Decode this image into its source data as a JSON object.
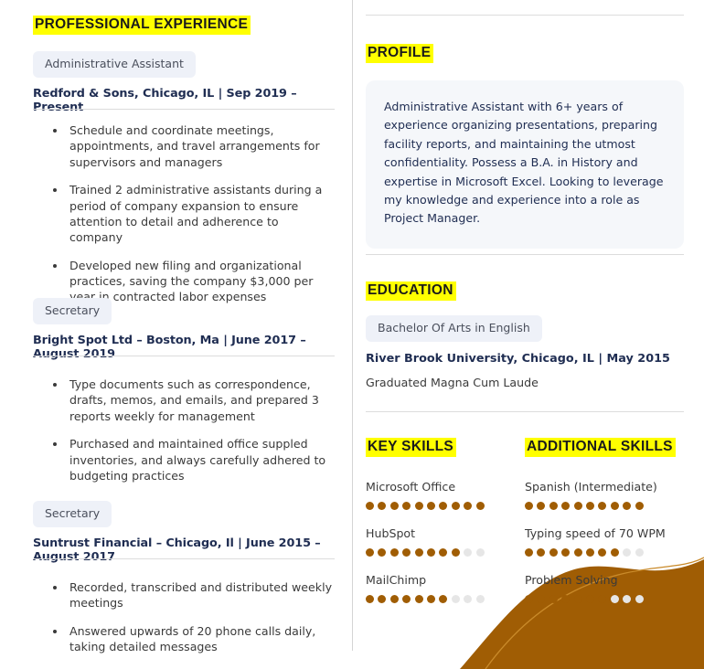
{
  "colors": {
    "highlight": "#ffff00",
    "accent_brown": "#a05d04",
    "navy": "#1f2d52",
    "pill_bg": "#eef1f8",
    "dot_empty": "#e6e6e6"
  },
  "left_column": {
    "heading": "PROFESSIONAL EXPERIENCE",
    "jobs": [
      {
        "title": "Administrative Assistant",
        "org": "Redford & Sons, Chicago, IL | Sep 2019 – Present",
        "bullets": [
          "Schedule and coordinate meetings, appointments, and travel arrangements for supervisors and managers",
          "Trained 2 administrative assistants during a period of company expansion to ensure attention to detail and adherence to company",
          "Developed new filing and organizational practices, saving the company $3,000 per year in contracted labor expenses"
        ]
      },
      {
        "title": "Secretary",
        "org": "Bright Spot Ltd – Boston, Ma | June 2017 – August 2019",
        "bullets": [
          "Type documents such as correspondence, drafts, memos, and emails, and prepared 3 reports weekly for management",
          "Purchased and maintained office suppled inventories, and always carefully adhered to budgeting practices"
        ]
      },
      {
        "title": "Secretary",
        "org": "Suntrust Financial – Chicago, Il | June 2015 – August 2017",
        "bullets": [
          "Recorded, transcribed and distributed weekly meetings",
          "Answered upwards of 20 phone calls daily, taking detailed messages"
        ]
      }
    ]
  },
  "right_column": {
    "profile": {
      "heading": "PROFILE",
      "text": "Administrative Assistant with 6+ years of experience organizing presentations, preparing facility reports, and maintaining the utmost confidentiality. Possess a B.A. in History and expertise in Microsoft Excel. Looking to leverage my knowledge and experience into a role as Project Manager."
    },
    "education": {
      "heading": "EDUCATION",
      "degree": "Bachelor Of Arts in English",
      "school": "River Brook University, Chicago, IL | May 2015",
      "honors": "Graduated Magna Cum Laude"
    },
    "key_skills": {
      "heading": "KEY SKILLS",
      "items": [
        {
          "name": "Microsoft Office",
          "rating": 10,
          "max": 10
        },
        {
          "name": "HubSpot",
          "rating": 8,
          "max": 10
        },
        {
          "name": "MailChimp",
          "rating": 7,
          "max": 10
        }
      ]
    },
    "additional_skills": {
      "heading": "ADDITIONAL SKILLS",
      "items": [
        {
          "name": "Spanish (Intermediate)",
          "rating": 10,
          "max": 10
        },
        {
          "name": "Typing speed of 70 WPM",
          "rating": 8,
          "max": 10
        },
        {
          "name": "Problem Solving",
          "rating": 7,
          "max": 10
        }
      ]
    }
  }
}
